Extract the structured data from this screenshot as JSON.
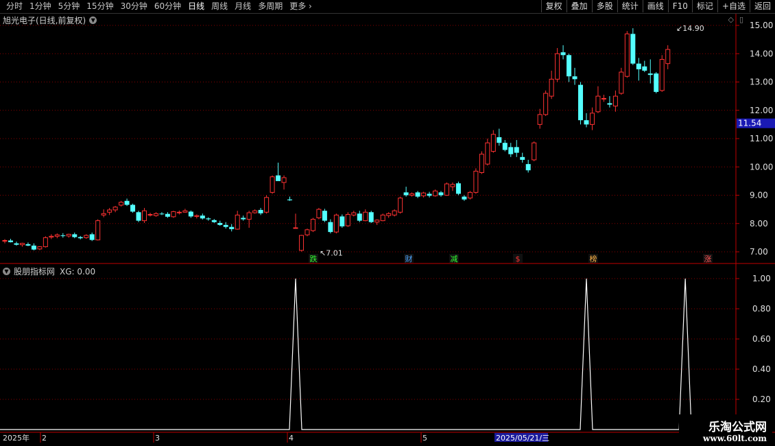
{
  "toolbar": {
    "periods": [
      "分时",
      "1分钟",
      "5分钟",
      "15分钟",
      "30分钟",
      "60分钟",
      "日线",
      "周线",
      "月线",
      "多周期",
      "更多"
    ],
    "active_period": "日线",
    "buttons": [
      "复权",
      "叠加",
      "多股",
      "统计",
      "画线",
      "F10",
      "标记",
      "+自选",
      "返回"
    ]
  },
  "stock": {
    "name": "旭光电子(日线,前复权)"
  },
  "indicator": {
    "name": "股朋指标网",
    "label": "XG: 0.00"
  },
  "price_axis": [
    "15.00",
    "14.00",
    "13.00",
    "12.00",
    "11.00",
    "10.00",
    "9.00",
    "8.00",
    "7.00"
  ],
  "current_price": "11.54",
  "indicator_axis": [
    "1.00",
    "0.80",
    "0.60",
    "0.40",
    "0.20"
  ],
  "annotations": {
    "high": "14.90",
    "low": "7.01"
  },
  "event_badges": [
    {
      "text": "跌",
      "color": "#33ff33"
    },
    {
      "text": "财",
      "color": "#4da6ff"
    },
    {
      "text": "减",
      "color": "#33ff33"
    },
    {
      "text": "$",
      "color": "#ff3333"
    },
    {
      "text": "榜",
      "color": "#ffb347"
    },
    {
      "text": "涨",
      "color": "#ff5555"
    }
  ],
  "time_axis": {
    "year_label": "2025年",
    "months": [
      "2",
      "3",
      "4",
      "5"
    ],
    "cursor_date": "2025/05/21/三"
  },
  "colors": {
    "up": "#ff3232",
    "down": "#54ffff",
    "grid": "#8b0000",
    "axis": "#c00000",
    "line": "#ffffff"
  },
  "logo": {
    "line1": "乐淘公式网",
    "line2": "www.60lt.com"
  },
  "chart_data": [
    {
      "type": "candlestick",
      "title": "旭光电子(日线,前复权)",
      "ylim": [
        6.7,
        15.3
      ],
      "candles": [
        {
          "o": 7.38,
          "h": 7.45,
          "l": 7.3,
          "c": 7.4
        },
        {
          "o": 7.4,
          "h": 7.46,
          "l": 7.33,
          "c": 7.34
        },
        {
          "o": 7.3,
          "h": 7.36,
          "l": 7.22,
          "c": 7.25
        },
        {
          "o": 7.25,
          "h": 7.32,
          "l": 7.18,
          "c": 7.3
        },
        {
          "o": 7.27,
          "h": 7.33,
          "l": 7.2,
          "c": 7.22
        },
        {
          "o": 7.22,
          "h": 7.3,
          "l": 7.05,
          "c": 7.08
        },
        {
          "o": 7.1,
          "h": 7.2,
          "l": 7.06,
          "c": 7.18
        },
        {
          "o": 7.18,
          "h": 7.55,
          "l": 7.15,
          "c": 7.5
        },
        {
          "o": 7.52,
          "h": 7.62,
          "l": 7.45,
          "c": 7.55
        },
        {
          "o": 7.55,
          "h": 7.65,
          "l": 7.48,
          "c": 7.6
        },
        {
          "o": 7.58,
          "h": 7.66,
          "l": 7.5,
          "c": 7.56
        },
        {
          "o": 7.56,
          "h": 7.64,
          "l": 7.5,
          "c": 7.62
        },
        {
          "o": 7.62,
          "h": 7.68,
          "l": 7.48,
          "c": 7.52
        },
        {
          "o": 7.52,
          "h": 7.56,
          "l": 7.44,
          "c": 7.48
        },
        {
          "o": 7.5,
          "h": 7.62,
          "l": 7.46,
          "c": 7.58
        },
        {
          "o": 7.62,
          "h": 7.68,
          "l": 7.38,
          "c": 7.42
        },
        {
          "o": 7.42,
          "h": 8.15,
          "l": 7.4,
          "c": 8.1
        },
        {
          "o": 8.3,
          "h": 8.5,
          "l": 8.22,
          "c": 8.35
        },
        {
          "o": 8.4,
          "h": 8.55,
          "l": 8.3,
          "c": 8.48
        },
        {
          "o": 8.48,
          "h": 8.62,
          "l": 8.4,
          "c": 8.58
        },
        {
          "o": 8.65,
          "h": 8.8,
          "l": 8.6,
          "c": 8.75
        },
        {
          "o": 8.8,
          "h": 8.88,
          "l": 8.62,
          "c": 8.66
        },
        {
          "o": 8.66,
          "h": 8.7,
          "l": 8.38,
          "c": 8.42
        },
        {
          "o": 8.4,
          "h": 8.45,
          "l": 8.05,
          "c": 8.1
        },
        {
          "o": 8.1,
          "h": 8.55,
          "l": 8.02,
          "c": 8.45
        },
        {
          "o": 8.3,
          "h": 8.38,
          "l": 8.25,
          "c": 8.32
        },
        {
          "o": 8.28,
          "h": 8.4,
          "l": 8.24,
          "c": 8.35
        },
        {
          "o": 8.35,
          "h": 8.4,
          "l": 8.3,
          "c": 8.33
        },
        {
          "o": 8.34,
          "h": 8.4,
          "l": 8.2,
          "c": 8.24
        },
        {
          "o": 8.24,
          "h": 8.45,
          "l": 8.2,
          "c": 8.42
        },
        {
          "o": 8.38,
          "h": 8.46,
          "l": 8.32,
          "c": 8.4
        },
        {
          "o": 8.4,
          "h": 8.52,
          "l": 8.38,
          "c": 8.45
        },
        {
          "o": 8.42,
          "h": 8.46,
          "l": 8.2,
          "c": 8.25
        },
        {
          "o": 8.25,
          "h": 8.32,
          "l": 8.18,
          "c": 8.28
        },
        {
          "o": 8.28,
          "h": 8.35,
          "l": 8.14,
          "c": 8.18
        },
        {
          "o": 8.18,
          "h": 8.22,
          "l": 8.1,
          "c": 8.15
        },
        {
          "o": 8.12,
          "h": 8.16,
          "l": 8.02,
          "c": 8.05
        },
        {
          "o": 8.02,
          "h": 8.1,
          "l": 7.92,
          "c": 7.95
        },
        {
          "o": 7.95,
          "h": 8.05,
          "l": 7.82,
          "c": 7.88
        },
        {
          "o": 7.88,
          "h": 7.98,
          "l": 7.72,
          "c": 7.8
        },
        {
          "o": 7.8,
          "h": 8.45,
          "l": 7.78,
          "c": 8.3
        },
        {
          "o": 8.2,
          "h": 8.28,
          "l": 8.1,
          "c": 8.15
        },
        {
          "o": 8.15,
          "h": 8.45,
          "l": 7.85,
          "c": 8.38
        },
        {
          "o": 8.38,
          "h": 8.5,
          "l": 8.35,
          "c": 8.45
        },
        {
          "o": 8.48,
          "h": 8.55,
          "l": 8.3,
          "c": 8.36
        },
        {
          "o": 8.4,
          "h": 9.0,
          "l": 8.35,
          "c": 8.92
        },
        {
          "o": 9.1,
          "h": 9.7,
          "l": 9.05,
          "c": 9.65
        },
        {
          "o": 9.7,
          "h": 10.15,
          "l": 9.6,
          "c": 9.5
        },
        {
          "o": 9.45,
          "h": 9.7,
          "l": 9.2,
          "c": 9.62
        },
        {
          "o": 8.85,
          "h": 8.95,
          "l": 8.8,
          "c": 8.82
        },
        {
          "o": 7.85,
          "h": 8.35,
          "l": 7.82,
          "c": 7.85
        },
        {
          "o": 7.05,
          "h": 7.6,
          "l": 7.01,
          "c": 7.58
        },
        {
          "o": 7.6,
          "h": 7.82,
          "l": 7.55,
          "c": 7.78
        },
        {
          "o": 7.75,
          "h": 8.2,
          "l": 7.7,
          "c": 8.15
        },
        {
          "o": 8.2,
          "h": 8.55,
          "l": 8.15,
          "c": 8.5
        },
        {
          "o": 8.45,
          "h": 8.52,
          "l": 8.05,
          "c": 8.1
        },
        {
          "o": 8.05,
          "h": 8.15,
          "l": 7.65,
          "c": 7.7
        },
        {
          "o": 7.7,
          "h": 8.35,
          "l": 7.65,
          "c": 8.3
        },
        {
          "o": 8.25,
          "h": 8.32,
          "l": 7.85,
          "c": 7.9
        },
        {
          "o": 7.92,
          "h": 8.4,
          "l": 7.88,
          "c": 8.32
        },
        {
          "o": 8.3,
          "h": 8.45,
          "l": 8.25,
          "c": 8.38
        },
        {
          "o": 8.35,
          "h": 8.45,
          "l": 8.05,
          "c": 8.1
        },
        {
          "o": 8.1,
          "h": 8.5,
          "l": 8.08,
          "c": 8.4
        },
        {
          "o": 8.4,
          "h": 8.45,
          "l": 8.02,
          "c": 8.05
        },
        {
          "o": 8.05,
          "h": 8.15,
          "l": 7.95,
          "c": 8.12
        },
        {
          "o": 8.1,
          "h": 8.35,
          "l": 8.08,
          "c": 8.3
        },
        {
          "o": 8.28,
          "h": 8.4,
          "l": 8.2,
          "c": 8.35
        },
        {
          "o": 8.3,
          "h": 8.5,
          "l": 8.25,
          "c": 8.45
        },
        {
          "o": 8.4,
          "h": 8.95,
          "l": 8.35,
          "c": 8.9
        },
        {
          "o": 9.1,
          "h": 9.3,
          "l": 8.95,
          "c": 9.0
        },
        {
          "o": 9.0,
          "h": 9.1,
          "l": 8.95,
          "c": 9.05
        },
        {
          "o": 9.1,
          "h": 9.15,
          "l": 8.9,
          "c": 8.95
        },
        {
          "o": 8.98,
          "h": 9.12,
          "l": 8.92,
          "c": 9.08
        },
        {
          "o": 9.05,
          "h": 9.12,
          "l": 8.92,
          "c": 8.98
        },
        {
          "o": 8.98,
          "h": 9.2,
          "l": 8.95,
          "c": 9.15
        },
        {
          "o": 9.1,
          "h": 9.15,
          "l": 8.95,
          "c": 9.0
        },
        {
          "o": 9.0,
          "h": 9.45,
          "l": 8.98,
          "c": 9.4
        },
        {
          "o": 9.3,
          "h": 9.45,
          "l": 9.15,
          "c": 9.38
        },
        {
          "o": 9.42,
          "h": 9.48,
          "l": 9.0,
          "c": 9.05
        },
        {
          "o": 8.95,
          "h": 9.0,
          "l": 8.8,
          "c": 8.85
        },
        {
          "o": 8.9,
          "h": 9.15,
          "l": 8.85,
          "c": 9.1
        },
        {
          "o": 9.1,
          "h": 9.95,
          "l": 9.05,
          "c": 9.85
        },
        {
          "o": 9.8,
          "h": 10.55,
          "l": 9.75,
          "c": 10.45
        },
        {
          "o": 10.1,
          "h": 11.0,
          "l": 10.05,
          "c": 10.85
        },
        {
          "o": 10.55,
          "h": 11.3,
          "l": 10.5,
          "c": 11.15
        },
        {
          "o": 11.05,
          "h": 11.35,
          "l": 10.75,
          "c": 10.85
        },
        {
          "o": 10.85,
          "h": 10.95,
          "l": 10.55,
          "c": 10.6
        },
        {
          "o": 10.7,
          "h": 10.85,
          "l": 10.35,
          "c": 10.45
        },
        {
          "o": 10.7,
          "h": 10.95,
          "l": 10.35,
          "c": 10.5
        },
        {
          "o": 10.35,
          "h": 10.5,
          "l": 10.15,
          "c": 10.25
        },
        {
          "o": 10.1,
          "h": 10.25,
          "l": 9.8,
          "c": 9.88
        },
        {
          "o": 10.25,
          "h": 10.9,
          "l": 10.2,
          "c": 10.85
        },
        {
          "o": 11.5,
          "h": 12.05,
          "l": 11.35,
          "c": 11.85
        },
        {
          "o": 11.85,
          "h": 12.7,
          "l": 11.8,
          "c": 12.6
        },
        {
          "o": 12.5,
          "h": 13.4,
          "l": 12.4,
          "c": 13.1
        },
        {
          "o": 13.1,
          "h": 14.2,
          "l": 13.0,
          "c": 14.0
        },
        {
          "o": 14.05,
          "h": 14.3,
          "l": 13.8,
          "c": 13.95
        },
        {
          "o": 13.95,
          "h": 14.0,
          "l": 13.0,
          "c": 13.2
        },
        {
          "o": 13.2,
          "h": 13.5,
          "l": 12.9,
          "c": 13.1
        },
        {
          "o": 12.9,
          "h": 13.0,
          "l": 11.5,
          "c": 11.65
        },
        {
          "o": 11.65,
          "h": 11.9,
          "l": 11.4,
          "c": 11.5
        },
        {
          "o": 11.5,
          "h": 12.1,
          "l": 11.3,
          "c": 11.9
        },
        {
          "o": 11.95,
          "h": 12.85,
          "l": 11.9,
          "c": 12.5
        },
        {
          "o": 12.4,
          "h": 12.55,
          "l": 12.3,
          "c": 12.42
        },
        {
          "o": 12.25,
          "h": 12.5,
          "l": 12.1,
          "c": 12.2
        },
        {
          "o": 12.15,
          "h": 12.7,
          "l": 11.95,
          "c": 12.5
        },
        {
          "o": 12.6,
          "h": 13.5,
          "l": 12.55,
          "c": 13.35
        },
        {
          "o": 13.2,
          "h": 14.8,
          "l": 13.15,
          "c": 14.7
        },
        {
          "o": 14.7,
          "h": 14.9,
          "l": 13.6,
          "c": 13.65
        },
        {
          "o": 13.65,
          "h": 13.85,
          "l": 13.05,
          "c": 13.45
        },
        {
          "o": 13.55,
          "h": 13.75,
          "l": 13.35,
          "c": 13.4
        },
        {
          "o": 13.3,
          "h": 13.8,
          "l": 12.95,
          "c": 13.25
        },
        {
          "o": 13.3,
          "h": 13.35,
          "l": 12.6,
          "c": 12.65
        },
        {
          "o": 12.7,
          "h": 13.95,
          "l": 12.65,
          "c": 13.8
        },
        {
          "o": 13.65,
          "h": 14.3,
          "l": 13.45,
          "c": 14.15
        }
      ]
    },
    {
      "type": "line",
      "title": "股朋指标网",
      "ylim": [
        0,
        1.0
      ],
      "series": [
        {
          "name": "XG",
          "spikes_at_bar_index": [
            50,
            100,
            117
          ]
        }
      ]
    }
  ]
}
